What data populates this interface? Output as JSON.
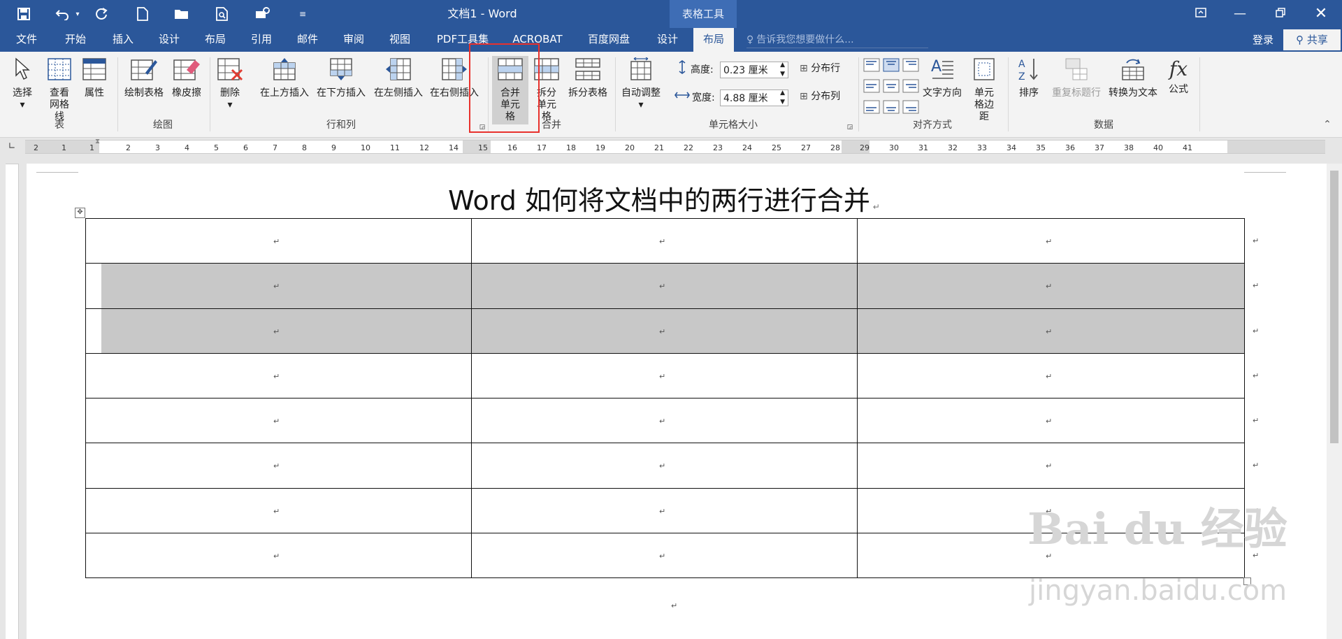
{
  "window": {
    "title": "文档1 - Word",
    "context_tab": "表格工具"
  },
  "tabs": [
    "文件",
    "开始",
    "插入",
    "设计",
    "布局",
    "引用",
    "邮件",
    "审阅",
    "视图",
    "PDF工具集",
    "ACROBAT",
    "百度网盘",
    "设计",
    "布局"
  ],
  "active_tab": "布局",
  "tell_me": "告诉我您想要做什么...",
  "account": {
    "login": "登录",
    "share": "共享"
  },
  "ribbon": {
    "table": {
      "select": "选择",
      "view_gridlines": "查看网格线",
      "properties": "属性",
      "group": "表"
    },
    "draw": {
      "draw_table": "绘制表格",
      "eraser": "橡皮擦",
      "group": "绘图"
    },
    "rows_cols": {
      "delete": "删除",
      "insert_above": "在上方插入",
      "insert_below": "在下方插入",
      "insert_left": "在左侧插入",
      "insert_right": "在右侧插入",
      "group": "行和列"
    },
    "merge": {
      "merge_cells": "合并单元格",
      "split_cells": "拆分单元格",
      "split_table": "拆分表格",
      "group": "合并"
    },
    "cell_size": {
      "autofit": "自动调整",
      "height_label": "高度:",
      "height_value": "0.23 厘米",
      "width_label": "宽度:",
      "width_value": "4.88 厘米",
      "distribute_rows": "分布行",
      "distribute_cols": "分布列",
      "group": "单元格大小"
    },
    "alignment": {
      "text_direction": "文字方向",
      "cell_margins": "单元格边距",
      "group": "对齐方式"
    },
    "data": {
      "sort": "排序",
      "repeat_header": "重复标题行",
      "convert_to_text": "转换为文本",
      "formula": "公式",
      "group": "数据"
    }
  },
  "ruler_numbers": [
    "2",
    "1",
    "1",
    "2",
    "3",
    "4",
    "5",
    "6",
    "7",
    "8",
    "9",
    "10",
    "11",
    "12",
    "14",
    "15",
    "16",
    "17",
    "18",
    "19",
    "20",
    "21",
    "22",
    "23",
    "24",
    "25",
    "27",
    "28",
    "29",
    "30",
    "31",
    "32",
    "33",
    "34",
    "35",
    "36",
    "37",
    "38",
    "40",
    "41"
  ],
  "document": {
    "title": "Word 如何将文档中的两行进行合并",
    "table": {
      "rows": 8,
      "cols": 3,
      "selected_rows": [
        1,
        2
      ]
    }
  },
  "watermark": {
    "brand": "Bai du 经验",
    "url": "jingyan.baidu.com"
  }
}
